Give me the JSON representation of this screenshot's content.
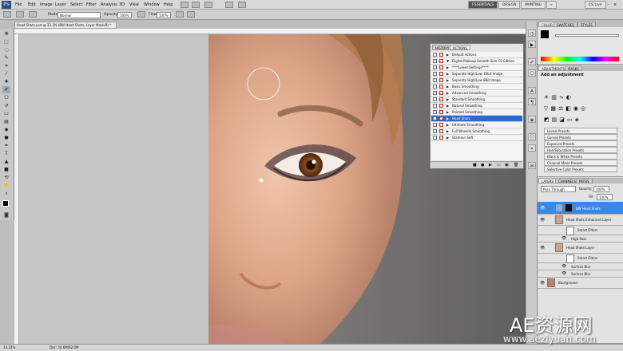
{
  "app": {
    "logo": "Ps"
  },
  "menu": [
    "File",
    "Edit",
    "Image",
    "Layer",
    "Select",
    "Filter",
    "Analysis",
    "3D",
    "View",
    "Window",
    "Help"
  ],
  "workspaces": {
    "essentials": "ESSENTIALS",
    "design": "DESIGN",
    "painting": "PAINTING",
    "more": "»",
    "cslive": "CS Live"
  },
  "options": {
    "mode_label": "Mode:",
    "mode_value": "Normal",
    "opacity_label": "Opacity:",
    "opacity_value": "100%",
    "flow_label": "Flow:",
    "flow_value": "100%"
  },
  "document": {
    "tab": "Head Shots.psd @ 33.3% (BW Head Shots, Layer Mask/8) *",
    "status_zoom": "33.33%",
    "status_doc": "Doc: 34.6M/92.0M"
  },
  "actions_panel": {
    "tabs": [
      "HISTORY",
      "ACTIONS"
    ],
    "items": [
      {
        "label": "Default Actions",
        "type": "set"
      },
      {
        "label": "Digital Makeup Smooth Skin CS Edition",
        "type": "set"
      },
      {
        "label": "****Lower Settings****",
        "type": "action"
      },
      {
        "label": "Separate High/Low 16bit Image",
        "type": "action"
      },
      {
        "label": "Separate High/Low 8Bit Image",
        "type": "action"
      },
      {
        "label": "Basic Smoothing",
        "type": "action"
      },
      {
        "label": "Advanced Smoothing",
        "type": "action"
      },
      {
        "label": "Standard Smoothing",
        "type": "action"
      },
      {
        "label": "Natural Smoothing",
        "type": "action"
      },
      {
        "label": "Painted Smoothing",
        "type": "action"
      },
      {
        "label": "Head Shots",
        "type": "action",
        "selected": true
      },
      {
        "label": "Ultimate Smoothing",
        "type": "action"
      },
      {
        "label": "Full Wheelie Smoothing",
        "type": "action"
      },
      {
        "label": "Glamour Soft",
        "type": "action"
      }
    ]
  },
  "color_panel": {
    "tabs": [
      "COLOR",
      "SWATCHES",
      "STYLES"
    ]
  },
  "adjustments_panel": {
    "tabs": [
      "ADJUSTMENTS",
      "MASKS"
    ],
    "title": "Add an adjustment",
    "presets": [
      "Levels Presets",
      "Curves Presets",
      "Exposure Presets",
      "Hue/Saturation Presets",
      "Black & White Presets",
      "Channel Mixer Presets",
      "Selective Color Presets"
    ]
  },
  "layers_panel": {
    "tabs": [
      "LAYERS",
      "CHANNELS",
      "PATHS"
    ],
    "blend": "Pass Through",
    "opacity_label": "Opacity:",
    "opacity_value": "100%",
    "fill_label": "Fill:",
    "fill_value": "100%",
    "layers": [
      {
        "name": "BW Head Shots",
        "selected": true
      },
      {
        "name": "Head Shots Enhanced Layer"
      },
      {
        "name": "Smart Filters"
      },
      {
        "name": "High Pass"
      },
      {
        "name": "Head Shots Layer"
      },
      {
        "name": "Smart Filters"
      },
      {
        "name": "Surface Blur"
      },
      {
        "name": "Surface Blur"
      },
      {
        "name": "Background"
      }
    ]
  },
  "watermark": {
    "title": "AE资源网",
    "url": "www.aeziyuan.com"
  },
  "colors": {
    "accent": "#2a6bd0",
    "selection": "#3b88e5",
    "panel": "#d5d5d5",
    "canvas": "#c6c6c6"
  }
}
